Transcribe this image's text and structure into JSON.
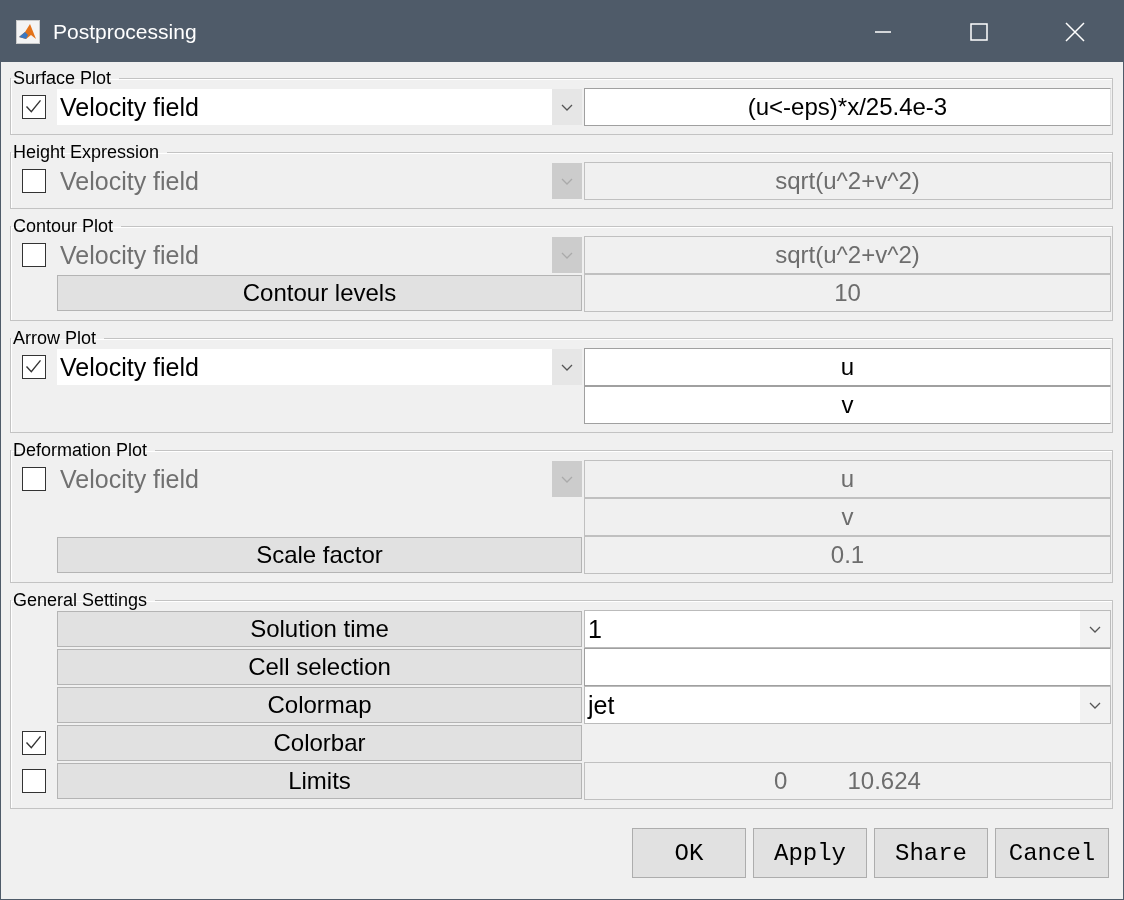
{
  "window": {
    "title": "Postprocessing"
  },
  "sections": [
    {
      "title": "Surface Plot",
      "rows": [
        {
          "checkbox": {
            "checked": true
          },
          "left": {
            "kind": "dropdown",
            "value": "Velocity field",
            "disabled": false
          },
          "right": {
            "kind": "field",
            "value": "(u<-eps)*x/25.4e-3",
            "disabled": false
          }
        }
      ]
    },
    {
      "title": "Height Expression",
      "rows": [
        {
          "checkbox": {
            "checked": false
          },
          "left": {
            "kind": "dropdown",
            "value": "Velocity field",
            "disabled": true
          },
          "right": {
            "kind": "field",
            "value": "sqrt(u^2+v^2)",
            "disabled": true
          }
        }
      ]
    },
    {
      "title": "Contour Plot",
      "rows": [
        {
          "checkbox": {
            "checked": false
          },
          "left": {
            "kind": "dropdown",
            "value": "Velocity field",
            "disabled": true
          },
          "right": {
            "kind": "field",
            "value": "sqrt(u^2+v^2)",
            "disabled": true
          }
        },
        {
          "left": {
            "kind": "button",
            "value": "Contour levels"
          },
          "right": {
            "kind": "field",
            "value": "10",
            "disabled": true
          }
        }
      ]
    },
    {
      "title": "Arrow Plot",
      "rows": [
        {
          "checkbox": {
            "checked": true
          },
          "left": {
            "kind": "dropdown",
            "value": "Velocity field",
            "disabled": false
          },
          "right": {
            "kind": "field",
            "value": "u",
            "disabled": false
          }
        },
        {
          "right": {
            "kind": "field",
            "value": "v",
            "disabled": false
          }
        }
      ]
    },
    {
      "title": "Deformation Plot",
      "rows": [
        {
          "checkbox": {
            "checked": false
          },
          "left": {
            "kind": "dropdown",
            "value": "Velocity field",
            "disabled": true
          },
          "right": {
            "kind": "field",
            "value": "u",
            "disabled": true
          }
        },
        {
          "right": {
            "kind": "field",
            "value": "v",
            "disabled": true
          }
        },
        {
          "left": {
            "kind": "button",
            "value": "Scale factor"
          },
          "right": {
            "kind": "field",
            "value": "0.1",
            "disabled": true
          }
        }
      ]
    },
    {
      "title": "General Settings",
      "rows": [
        {
          "left": {
            "kind": "button",
            "value": "Solution time"
          },
          "right": {
            "kind": "dropdown",
            "value": "1",
            "disabled": false
          }
        },
        {
          "left": {
            "kind": "button",
            "value": "Cell selection"
          },
          "right": {
            "kind": "field",
            "disabled": false
          }
        },
        {
          "left": {
            "kind": "button",
            "value": "Colormap"
          },
          "right": {
            "kind": "dropdown",
            "value": "jet",
            "disabled": false
          }
        },
        {
          "checkbox": {
            "checked": true
          },
          "left": {
            "kind": "button",
            "value": "Colorbar"
          }
        },
        {
          "checkbox": {
            "checked": false
          },
          "left": {
            "kind": "button",
            "value": "Limits"
          },
          "right": {
            "kind": "range",
            "values": [
              "0",
              "10.624"
            ],
            "disabled": true
          }
        }
      ]
    }
  ],
  "buttons": [
    "OK",
    "Apply",
    "Share",
    "Cancel"
  ]
}
